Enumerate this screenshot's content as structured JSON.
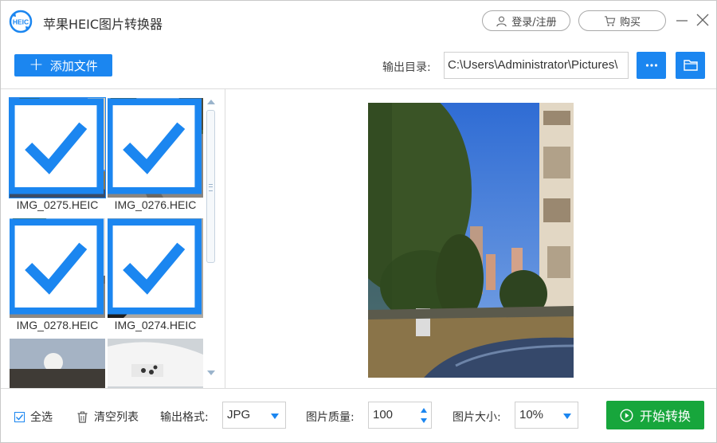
{
  "app": {
    "title": "苹果HEIC图片转换器",
    "logo_text": "HEIC",
    "accent_color": "#1b86f0",
    "start_color": "#17a63c"
  },
  "header": {
    "login_label": "登录/注册",
    "buy_label": "购买",
    "login_icon": "user-icon",
    "buy_icon": "cart-icon",
    "minimize_icon": "minimize-icon",
    "close_icon": "close-icon"
  },
  "toolbar": {
    "add_files_label": "添加文件",
    "output_dir_label": "输出目录:",
    "output_dir_value": "C:\\Users\\Administrator\\Pictures\\",
    "more_icon": "more-dots-icon",
    "open_folder_icon": "folder-icon"
  },
  "files": [
    {
      "name": "IMG_0275.HEIC",
      "selected": true,
      "checked": true
    },
    {
      "name": "IMG_0276.HEIC",
      "selected": false,
      "checked": true
    },
    {
      "name": "IMG_0278.HEIC",
      "selected": false,
      "checked": true
    },
    {
      "name": "IMG_0274.HEIC",
      "selected": false,
      "checked": true
    },
    {
      "name": "",
      "selected": false,
      "checked": false
    },
    {
      "name": "",
      "selected": false,
      "checked": false
    }
  ],
  "bottom": {
    "select_all_label": "全选",
    "select_all_checked": true,
    "clear_list_label": "清空列表",
    "format_label": "输出格式:",
    "format_value": "JPG",
    "quality_label": "图片质量:",
    "quality_value": "100",
    "size_label": "图片大小:",
    "size_value": "10%",
    "start_label": "开始转换"
  }
}
